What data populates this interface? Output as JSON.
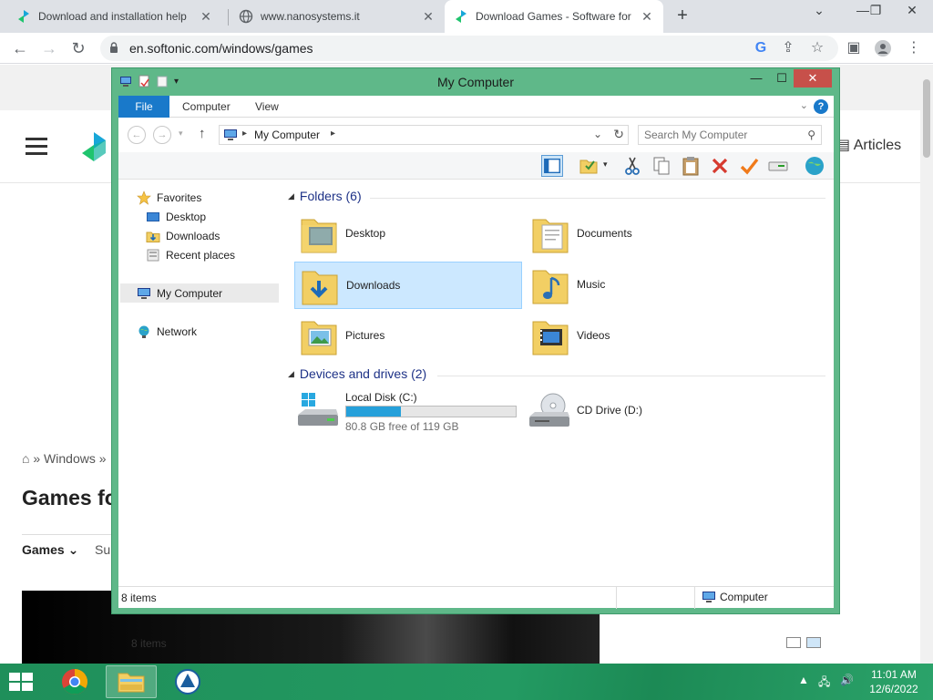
{
  "browser": {
    "tabs": [
      {
        "title": "Download and installation help",
        "active": false
      },
      {
        "title": "www.nanosystems.it",
        "active": false
      },
      {
        "title": "Download Games - Software for",
        "active": true
      }
    ],
    "url": "en.softonic.com/windows/games"
  },
  "website": {
    "articles_label": "Articles",
    "breadcrumb": "Windows",
    "heading": "Games fo",
    "tab_games": "Games",
    "tab_sub": "Su"
  },
  "explorer": {
    "title": "My Computer",
    "ribbon_tabs": [
      "File",
      "Computer",
      "View"
    ],
    "address_path": "My Computer",
    "search_placeholder": "Search My Computer",
    "nav": {
      "favorites": "Favorites",
      "desktop": "Desktop",
      "downloads": "Downloads",
      "recent": "Recent places",
      "my_computer": "My Computer",
      "network": "Network"
    },
    "folders_header": "Folders (6)",
    "folders": [
      {
        "name": "Desktop"
      },
      {
        "name": "Documents"
      },
      {
        "name": "Downloads"
      },
      {
        "name": "Music"
      },
      {
        "name": "Pictures"
      },
      {
        "name": "Videos"
      }
    ],
    "selected_folder": "Downloads",
    "drives_header": "Devices and drives (2)",
    "drives": [
      {
        "name": "Local Disk (C:)",
        "free_text": "80.8 GB free of 119 GB",
        "used_fraction": 0.32
      },
      {
        "name": "CD Drive (D:)"
      }
    ],
    "item_count": "8 items",
    "status_left": "8 items",
    "status_right": "Computer"
  },
  "taskbar": {
    "time": "11:01 AM",
    "date": "12/6/2022"
  },
  "colors": {
    "window_frame": "#5fb889",
    "taskbar": "#1f8f5a",
    "selection": "#cce8ff",
    "drive_bar": "#26a0da",
    "group_header": "#1e3287"
  }
}
